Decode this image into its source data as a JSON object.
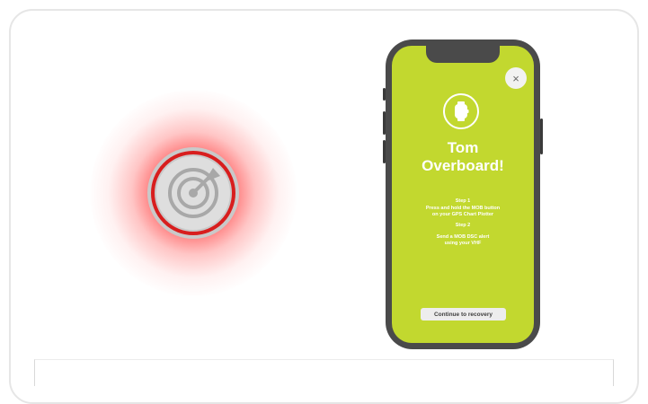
{
  "colors": {
    "screen_accent": "#c2d82f",
    "beacon_ring": "#d81e1e",
    "beacon_glow": "#ff3a3a",
    "phone_body": "#4a4a4a"
  },
  "icons": {
    "beacon": "radar-target-icon",
    "watch": "smartwatch-icon",
    "close": "close-icon"
  },
  "alert": {
    "close_glyph": "×",
    "title_line1": "Tom",
    "title_line2": "Overboard!",
    "step1_heading": "Step 1",
    "step1_line1": "Press and hold the MOB button",
    "step1_line2": "on your GPS Chart Plotter",
    "step2_heading": "Step 2",
    "step2_line1": "Send a MOB DSC alert",
    "step2_line2": "using your VHF",
    "cta_label": "Continue to recovery"
  }
}
